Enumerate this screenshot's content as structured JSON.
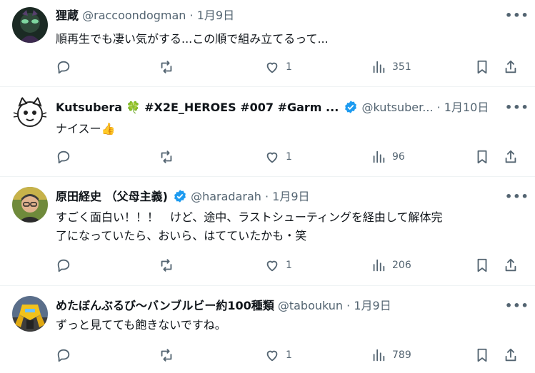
{
  "tweets": [
    {
      "display_name": "狸蔵",
      "handle": "@raccoondogman",
      "date": "1月9日",
      "text": "順再生でも凄い気がする...この順で組み立てるって...",
      "likes": "1",
      "views": "351",
      "verified": false,
      "avatar": "raccoon-dog-avatar"
    },
    {
      "display_name": "Kutsubera 🍀 #X2E_HEROES #007 #Garm ...",
      "handle": "@kutsuber...",
      "date": "1月10日",
      "text": "ナイスー👍",
      "likes": "1",
      "views": "96",
      "verified": true,
      "avatar": "cartoon-cat-avatar"
    },
    {
      "display_name": "原田経史 （父母主義)",
      "handle": "@haradarah",
      "date": "1月9日",
      "text": "すごく面白い！！！　けど、途中、ラストシューティングを経由して解体完\n了になっていたら、おいら、はてていたかも・笑",
      "likes": "1",
      "views": "206",
      "verified": true,
      "avatar": "person-photo-avatar"
    },
    {
      "display_name": "めたぼんぶるび～バンブルビー約100種類",
      "handle": "@taboukun",
      "date": "1月9日",
      "text": "ずっと見てても飽きないですね。",
      "likes": "1",
      "views": "789",
      "verified": false,
      "avatar": "bumblebee-figure-avatar"
    }
  ],
  "colors": {
    "muted": "#536471",
    "verified": "#1d9bf0",
    "divider": "#eff3f4"
  }
}
